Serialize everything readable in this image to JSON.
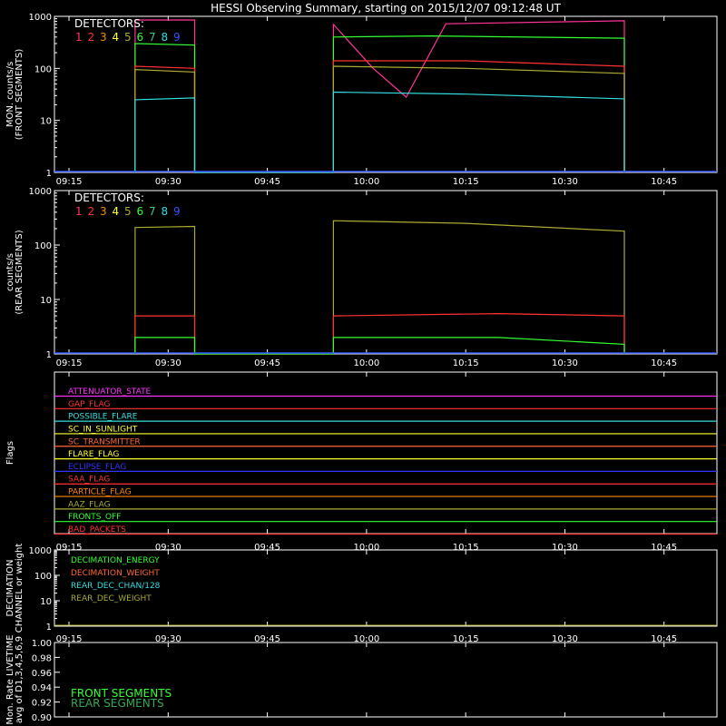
{
  "title": "HESSI Observing Summary, starting on 2015/12/07 09:12:48 UT",
  "time_ticks": [
    "09:15",
    "09:30",
    "09:45",
    "10:00",
    "10:15",
    "10:30",
    "10:45"
  ],
  "detector_colors": [
    "#ff3366",
    "#ff3333",
    "#ff8800",
    "#ffff33",
    "#aaaa33",
    "#33ff33",
    "#33cc88",
    "#33dddd",
    "#3355ff"
  ],
  "chart_data": [
    {
      "type": "line",
      "ylabel": [
        "MON. counts/s",
        "(FRONT SEGMENTS)"
      ],
      "yscale": "log",
      "ylim": [
        1,
        1000
      ],
      "y_ticks": [
        "1",
        "10",
        "100",
        "1000"
      ],
      "xlim": [
        "09:12:48",
        "10:53:00"
      ],
      "legend": {
        "title": "DETECTORS:",
        "labels": [
          "1",
          "2",
          "3",
          "4",
          "5",
          "6",
          "7",
          "8",
          "9"
        ]
      },
      "series": [
        {
          "color": "#ff3399",
          "x": [
            "09:25",
            "09:25",
            "09:34",
            "09:34",
            "09:55",
            "09:55",
            "10:01",
            "10:06",
            "10:12",
            "10:39",
            "10:39"
          ],
          "y": [
            1,
            850,
            850,
            1,
            1,
            700,
            100,
            28,
            720,
            820,
            1
          ]
        },
        {
          "color": "#33ff33",
          "x": [
            "09:25",
            "09:25",
            "09:34",
            "09:34",
            "09:55",
            "09:55",
            "10:10",
            "10:39",
            "10:39"
          ],
          "y": [
            1,
            300,
            280,
            1,
            1,
            400,
            420,
            380,
            1
          ]
        },
        {
          "color": "#ff3333",
          "x": [
            "09:25",
            "09:25",
            "09:34",
            "09:34",
            "09:55",
            "09:55",
            "10:15",
            "10:39",
            "10:39"
          ],
          "y": [
            1,
            110,
            100,
            1,
            1,
            140,
            140,
            110,
            1
          ]
        },
        {
          "color": "#aaaa33",
          "x": [
            "09:25",
            "09:25",
            "09:34",
            "09:34",
            "09:55",
            "09:55",
            "10:15",
            "10:39",
            "10:39"
          ],
          "y": [
            1,
            95,
            85,
            1,
            1,
            110,
            100,
            80,
            1
          ]
        },
        {
          "color": "#33dddd",
          "x": [
            "09:25",
            "09:25",
            "09:34",
            "09:34",
            "09:55",
            "09:55",
            "10:15",
            "10:39",
            "10:39"
          ],
          "y": [
            1,
            25,
            27,
            1,
            1,
            35,
            32,
            26,
            1
          ]
        }
      ]
    },
    {
      "type": "line",
      "ylabel": [
        "counts/s",
        "(REAR SEGMENTS)"
      ],
      "yscale": "log",
      "ylim": [
        1,
        1000
      ],
      "y_ticks": [
        "1",
        "10",
        "100",
        "1000"
      ],
      "xlim": [
        "09:12:48",
        "10:53:00"
      ],
      "legend": {
        "title": "DETECTORS:",
        "labels": [
          "1",
          "2",
          "3",
          "4",
          "5",
          "6",
          "7",
          "8",
          "9"
        ]
      },
      "series": [
        {
          "color": "#aaaa33",
          "x": [
            "09:25",
            "09:25",
            "09:34",
            "09:34",
            "09:55",
            "09:55",
            "10:15",
            "10:39",
            "10:39"
          ],
          "y": [
            1,
            210,
            220,
            1,
            1,
            280,
            250,
            180,
            1
          ]
        },
        {
          "color": "#ff3333",
          "x": [
            "09:25",
            "09:25",
            "09:34",
            "09:34",
            "09:55",
            "09:55",
            "10:20",
            "10:39",
            "10:39"
          ],
          "y": [
            1,
            5,
            5,
            1,
            1,
            5,
            5.5,
            5,
            1
          ]
        },
        {
          "color": "#33ff33",
          "x": [
            "09:25",
            "09:25",
            "09:34",
            "09:34",
            "09:55",
            "09:55",
            "10:20",
            "10:39",
            "10:39"
          ],
          "y": [
            1,
            2,
            2,
            1,
            1,
            2,
            2,
            1.5,
            1
          ]
        }
      ]
    },
    {
      "type": "table",
      "ylabel": [
        "Flags"
      ],
      "flags": [
        {
          "name": "ATTENUATOR_STATE",
          "color": "#ff33ff"
        },
        {
          "name": "GAP_FLAG",
          "color": "#ff3333"
        },
        {
          "name": "POSSIBLE_FLARE",
          "color": "#33dddd"
        },
        {
          "name": "SC_IN_SUNLIGHT",
          "color": "#ffff33"
        },
        {
          "name": "SC_TRANSMITTER",
          "color": "#ff6633"
        },
        {
          "name": "FLARE_FLAG",
          "color": "#ffff33"
        },
        {
          "name": "ECLIPSE_FLAG",
          "color": "#3333ff"
        },
        {
          "name": "SAA_FLAG",
          "color": "#ff3333"
        },
        {
          "name": "PARTICLE_FLAG",
          "color": "#ff8800"
        },
        {
          "name": "AAZ_FLAG",
          "color": "#aaaa33"
        },
        {
          "name": "FRONTS_OFF",
          "color": "#33ff33"
        },
        {
          "name": "BAD_PACKETS",
          "color": "#ff3333"
        }
      ]
    },
    {
      "type": "line",
      "ylabel": [
        "DECIMATION",
        "CHANNEL or weight"
      ],
      "yscale": "log",
      "ylim": [
        1,
        1000
      ],
      "y_ticks": [
        "1",
        "10",
        "100",
        "1000"
      ],
      "legend": {
        "labels": [
          "DECIMATION_ENERGY",
          "DECIMATION_WEIGHT",
          "REAR_DEC_CHAN/128",
          "REAR_DEC_WEIGHT"
        ],
        "colors": [
          "#33ff33",
          "#ff6633",
          "#33dddd",
          "#aaaa33"
        ]
      }
    },
    {
      "type": "line",
      "ylabel": [
        "Mon. Rate LIVETIME",
        "avg of D1,3,4,5,6,9"
      ],
      "ylim": [
        0.9,
        1.0
      ],
      "y_ticks": [
        "0.90",
        "0.92",
        "0.94",
        "0.96",
        "0.98",
        "1.00"
      ],
      "legend": {
        "labels": [
          "FRONT SEGMENTS",
          "REAR SEGMENTS"
        ],
        "colors": [
          "#33ff33",
          "#33aa55"
        ]
      }
    }
  ]
}
